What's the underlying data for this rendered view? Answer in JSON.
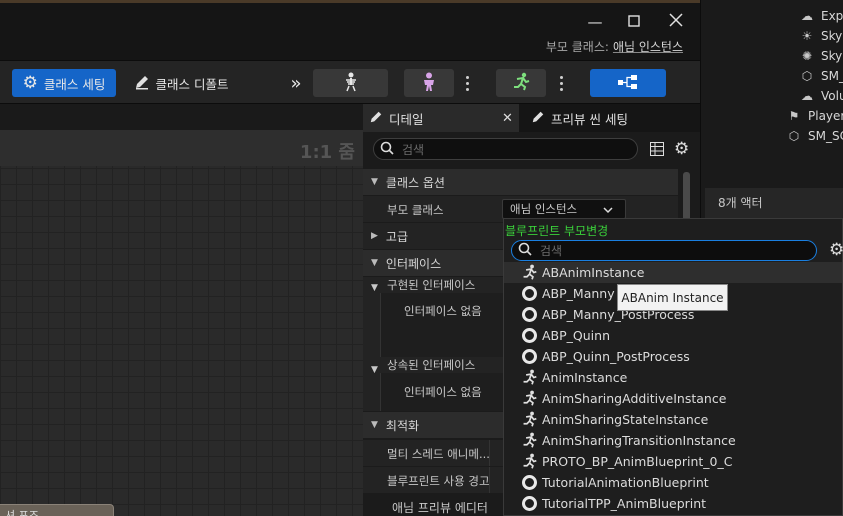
{
  "window": {
    "parent_class_label": "부모 클래스:",
    "parent_class_value": "애님 인스턴스"
  },
  "toolbar": {
    "class_settings": "클래스 세팅",
    "class_defaults": "클래스 디폴트"
  },
  "viewport": {
    "zoom": "1:1 줌",
    "bottom_tab": "셔 포즈"
  },
  "details": {
    "tab_details": "디테일",
    "tab_preview": "프리뷰 씬 세팅",
    "search_placeholder": "검색",
    "cat_class_options": "클래스 옵션",
    "parent_class_label": "부모 클래스",
    "parent_class_value": "애님 인스턴스",
    "cat_advanced": "고급",
    "cat_interfaces": "인터페이스",
    "implemented_interfaces": "구현된 인터페이스",
    "no_interfaces_1": "인터페이스 없음",
    "inherited_interfaces": "상속된 인터페이스",
    "no_interfaces_2": "인터페이스 없음",
    "cat_optimization": "최적화",
    "multi_thread": "멀티 스레드 애니메...",
    "blueprint_usage_warning": "블루프린트 사용 경고",
    "anim_preview_editor": "애님 프리뷰 에디터"
  },
  "outliner": {
    "items": [
      "Expe",
      "Sky",
      "Sky",
      "SM_",
      "Volu",
      "Player",
      "SM_SC"
    ],
    "actor_count": "8개 액터"
  },
  "popup": {
    "title": "블루프린트 부모변경",
    "search_placeholder": "검색",
    "items": [
      {
        "label": "ABAnimInstance",
        "icon": "anim-icon"
      },
      {
        "label": "ABP_Manny",
        "icon": "ring-icon"
      },
      {
        "label": "ABP_Manny_PostProcess",
        "icon": "ring-icon"
      },
      {
        "label": "ABP_Quinn",
        "icon": "ring-icon"
      },
      {
        "label": "ABP_Quinn_PostProcess",
        "icon": "ring-icon"
      },
      {
        "label": "AnimInstance",
        "icon": "anim-icon"
      },
      {
        "label": "AnimSharingAdditiveInstance",
        "icon": "anim-icon"
      },
      {
        "label": "AnimSharingStateInstance",
        "icon": "anim-icon"
      },
      {
        "label": "AnimSharingTransitionInstance",
        "icon": "anim-icon"
      },
      {
        "label": "PROTO_BP_AnimBlueprint_0_C",
        "icon": "anim-icon"
      },
      {
        "label": "TutorialAnimationBlueprint",
        "icon": "ring-icon"
      },
      {
        "label": "TutorialTPP_AnimBlueprint",
        "icon": "ring-icon"
      }
    ],
    "tooltip": "ABAnim Instance"
  }
}
